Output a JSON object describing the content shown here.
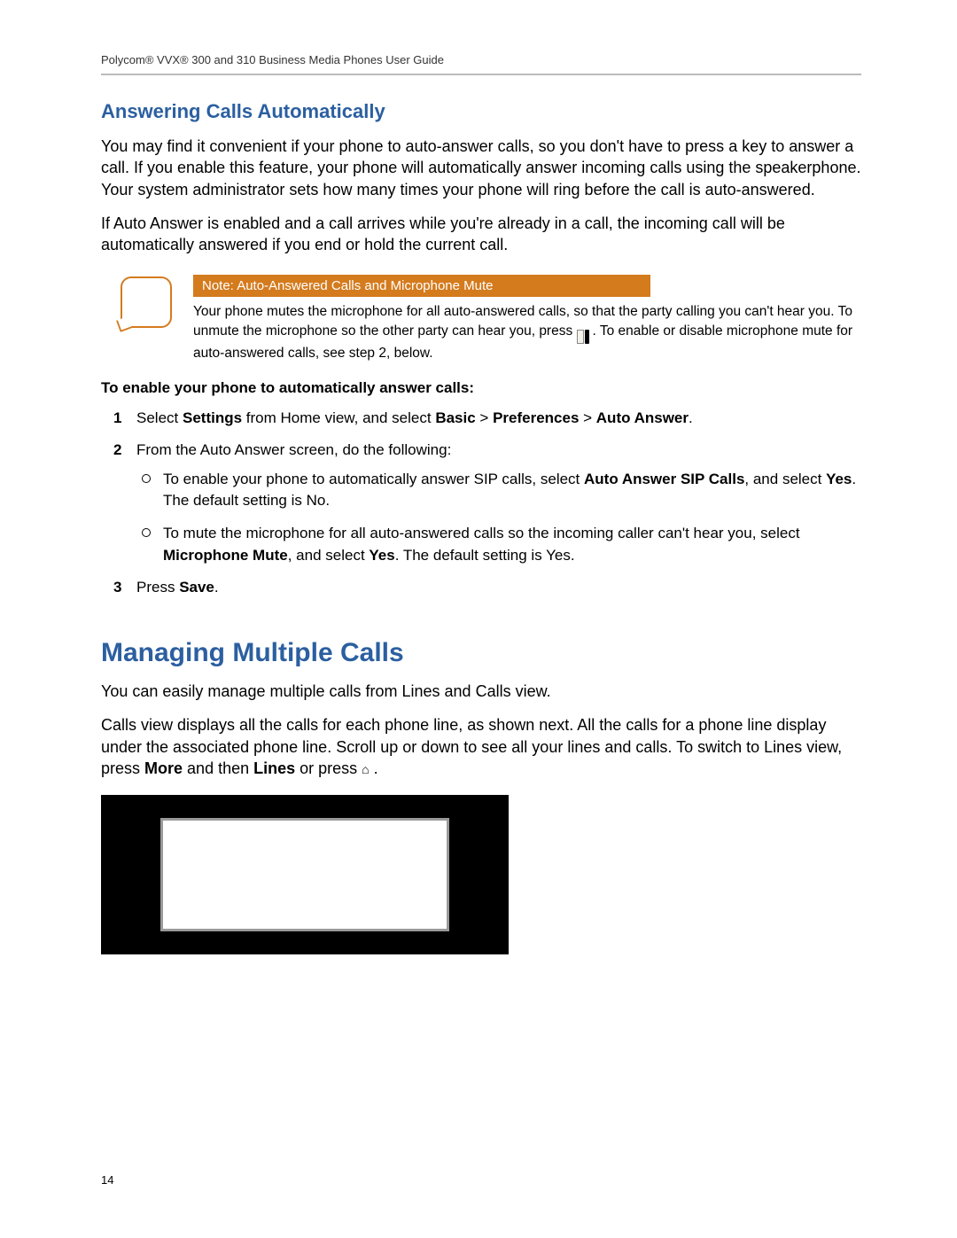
{
  "header": "Polycom® VVX® 300 and 310 Business Media Phones User Guide",
  "section1": {
    "heading": "Answering Calls Automatically",
    "p1": "You may find it convenient if your phone to auto-answer calls, so you don't have to press a key to answer a call. If you enable this feature, your phone will automatically answer incoming calls using the speakerphone. Your system administrator sets how many times your phone will ring before the call is auto-answered.",
    "p2": "If Auto Answer is enabled and a call arrives while you're already in a call, the incoming call will be automatically answered if you end or hold the current call."
  },
  "note": {
    "title": "Note: Auto-Answered Calls and Microphone Mute",
    "body1": "Your phone mutes the microphone for all auto-answered calls, so that the party calling you can't hear you. To unmute the microphone so the other party can hear you, press ",
    "body2": ". To enable or disable microphone mute for auto-answered calls, see step 2, below."
  },
  "instr": {
    "heading": "To enable your phone to automatically answer calls:",
    "step1_a": "Select ",
    "step1_settings": "Settings",
    "step1_b": " from Home view, and select ",
    "step1_basic": "Basic",
    "step1_gt1": " > ",
    "step1_pref": "Preferences",
    "step1_gt2": " > ",
    "step1_auto": "Auto Answer",
    "step1_c": ".",
    "step2_intro": "From the Auto Answer screen, do the following:",
    "step2a_1": "To enable your phone to automatically answer SIP calls, select ",
    "step2a_b1": "Auto Answer SIP Calls",
    "step2a_2": ", and select ",
    "step2a_b2": "Yes",
    "step2a_3": ". The default setting is No.",
    "step2b_1": "To mute the microphone for all auto-answered calls so the incoming caller can't hear you, select ",
    "step2b_b1": "Microphone Mute",
    "step2b_2": ", and select ",
    "step2b_b2": "Yes",
    "step2b_3": ". The default setting is Yes.",
    "step3_a": "Press ",
    "step3_b": "Save",
    "step3_c": "."
  },
  "section2": {
    "heading": "Managing Multiple Calls",
    "p1": "You can easily manage multiple calls from Lines and Calls view.",
    "p2_a": "Calls view displays all the calls for each phone line, as shown next. All the calls for a phone line display under the associated phone line. Scroll up or down to see all your lines and calls. To switch to Lines view, press ",
    "p2_more": "More",
    "p2_b": " and then ",
    "p2_lines": "Lines",
    "p2_c": " or press  ",
    "p2_d": " ."
  },
  "page_number": "14"
}
